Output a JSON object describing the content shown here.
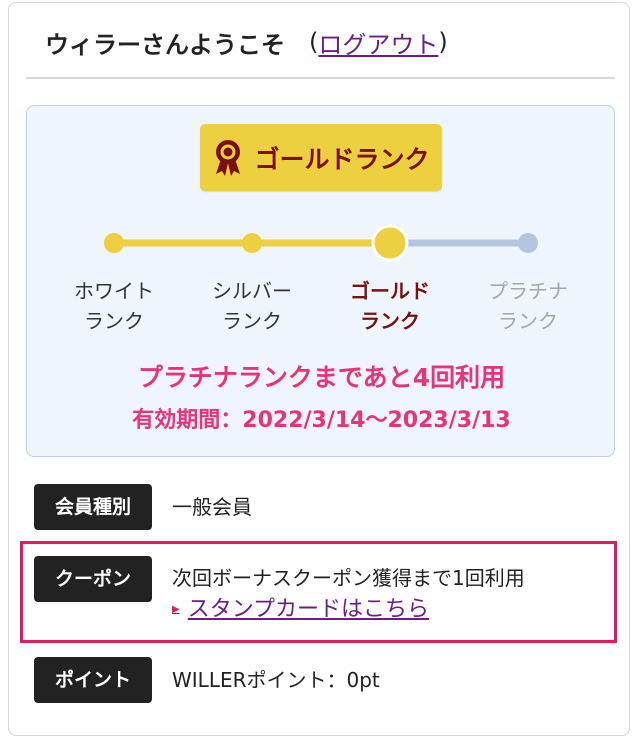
{
  "header": {
    "welcome": "ウィラーさんようこそ",
    "paren_open": "(",
    "logout": "ログアウト",
    "paren_close": ")"
  },
  "rank": {
    "badge_label": "ゴールドランク",
    "badge_icon": "medal-icon",
    "current_index": 2,
    "steps": [
      {
        "line1": "ホワイト",
        "line2": "ランク"
      },
      {
        "line1": "シルバー",
        "line2": "ランク"
      },
      {
        "line1": "ゴールド",
        "line2": "ランク"
      },
      {
        "line1": "プラチナ",
        "line2": "ランク"
      }
    ],
    "progress_message": "プラチナランクまであと4回利用",
    "validity": "有効期間：2022/3/14〜2023/3/13"
  },
  "member": {
    "type_label": "会員種別",
    "type_value": "一般会員"
  },
  "coupon": {
    "label": "クーポン",
    "message": "次回ボーナスクーポン獲得まで1回利用",
    "link": "スタンプカードはこちら"
  },
  "points": {
    "label": "ポイント",
    "value": "WILLERポイント：0pt"
  },
  "colors": {
    "gold": "#ecd040",
    "gold_dark": "#7a1010",
    "platinum_track": "#b4c6df",
    "pink": "#e8337c",
    "highlight_frame": "#e5195e"
  }
}
